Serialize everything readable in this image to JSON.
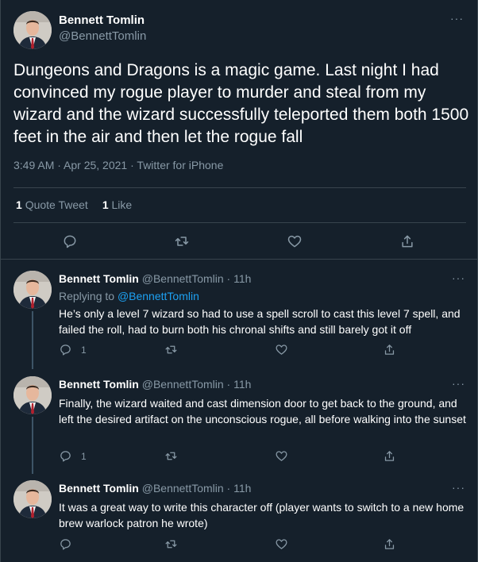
{
  "main_tweet": {
    "name": "Bennett Tomlin",
    "handle": "@BennettTomlin",
    "more": "···",
    "text": "Dungeons and Dragons is a magic game. Last night I had convinced my rogue player to murder and steal from my wizard and the wizard successfully teleported them both 1500 feet in the air and then let the rogue fall",
    "time": "3:49 AM · Apr 25, 2021",
    "separator": " · ",
    "source": "Twitter for iPhone",
    "quote_count": "1",
    "quote_label": "Quote Tweet",
    "like_count": "1",
    "like_label": "Like"
  },
  "replies": [
    {
      "name": "Bennett Tomlin",
      "meta": "@BennettTomlin · 11h",
      "replying_prefix": "Replying to ",
      "replying_to": "@BennettTomlin",
      "text": "He’s only a level 7 wizard so had to use a spell scroll to cast this level 7 spell, and failed the roll, had to burn both his chronal shifts and still barely got it off",
      "reply_count": "1",
      "more": "···"
    },
    {
      "name": "Bennett Tomlin",
      "meta": "@BennettTomlin · 11h",
      "text": "Finally, the wizard waited and cast dimension door to get back to the ground, and left the desired artifact on the unconscious rogue, all before walking into the sunset",
      "reply_count": "1",
      "more": "···"
    },
    {
      "name": "Bennett Tomlin",
      "meta": "@BennettTomlin · 11h",
      "text": "It was a great way to write this character off (player wants to switch to a new home brew warlock patron he wrote)",
      "reply_count": "",
      "more": "···"
    }
  ],
  "colors": {
    "background": "#15202b",
    "border": "#38444d",
    "muted": "#8899a6",
    "link": "#1da1f2"
  },
  "icons": [
    "reply-icon",
    "retweet-icon",
    "like-icon",
    "share-icon",
    "more-icon"
  ]
}
